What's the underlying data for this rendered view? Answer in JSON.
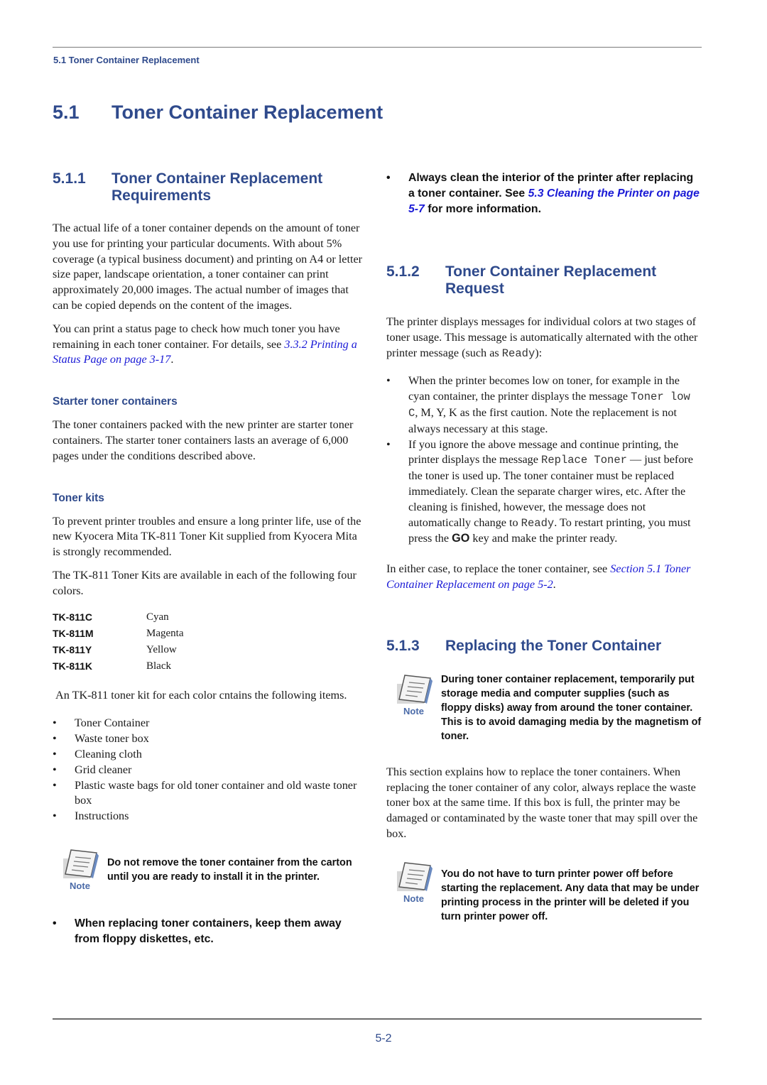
{
  "header": {
    "running_title": "5.1 Toner Container Replacement"
  },
  "section": {
    "number": "5.1",
    "title": "Toner Container Replacement"
  },
  "left": {
    "s511": {
      "number": "5.1.1",
      "title_line1": "Toner Container Replacement",
      "title_line2": "Requirements"
    },
    "para1": "The actual life of a toner container depends on the amount of toner you use for printing your particular documents.  With about 5% coverage (a typical business document) and printing on A4 or letter size paper, landscape orientation, a toner container can print approximately 20,000 images. The actual number of images that can be copied depends on the content of the images.",
    "para2_text": "You can print a status page to check how much toner you have remaining in each toner container. For details, see ",
    "para2_link": "3.3.2 Printing a Status Page on page 3-17",
    "para2_end": ".",
    "starter_heading": "Starter toner containers",
    "starter_para": "The toner containers packed with the new printer are starter toner containers. The starter toner containers lasts an average of 6,000 pages under the conditions described above.",
    "kits_heading": "Toner kits",
    "kits_para1": "To prevent printer troubles and ensure a long printer life, use of the new Kyocera Mita TK-811 Toner Kit supplied from Kyocera Mita is strongly recommended.",
    "kits_para2": "The TK-811 Toner Kits are available in each of the following four colors.",
    "kits": [
      {
        "code": "TK-811C",
        "color": "Cyan"
      },
      {
        "code": "TK-811M",
        "color": "Magenta"
      },
      {
        "code": "TK-811Y",
        "color": "Yellow"
      },
      {
        "code": "TK-811K",
        "color": "Black"
      }
    ],
    "contents_para": " An TK-811 toner kit for each color cntains the following items.",
    "contents": [
      "Toner Container",
      "Waste toner box",
      "Cleaning cloth",
      "Grid cleaner",
      "Plastic waste bags for old toner container and old waste toner box",
      "Instructions"
    ],
    "note": {
      "label": "Note",
      "text": "Do not remove the toner container from the carton until you are ready to install it in the printer."
    },
    "warning": "When replacing toner containers, keep them away from floppy diskettes, etc."
  },
  "right": {
    "clean_bullet_pre": "Always clean the interior of the printer after replacing a toner container. See ",
    "clean_bullet_link": "5.3 Cleaning the Printer on page 5-7",
    "clean_bullet_post": " for more information.",
    "s512": {
      "number": "5.1.2",
      "title_line1": "Toner Container Replacement",
      "title_line2": "Request"
    },
    "request_para_pre": "The printer displays messages for individual colors at two stages of toner usage. This message is automatically alternated with the other printer message (such as ",
    "request_para_code": "Ready",
    "request_para_post": "):",
    "bullet1_pre": "When the printer becomes low on toner, for example in the cyan container, the printer displays the message ",
    "bullet1_code": "Toner low C",
    "bullet1_mid": ", M, Y, K as the first caution. Note the replacement is not always necessary at this stage.",
    "bullet2_pre": "If you ignore the above message and continue printing, the printer displays the message ",
    "bullet2_code": "Replace Toner",
    "bullet2_mid": " — just before the toner is used up. The toner container must be replaced immediately. Clean the separate charger wires, etc. After the cleaning is finished, however, the message does not automatically change to ",
    "bullet2_code2": "Ready",
    "bullet2_mid2": ". To restart printing, you must press the ",
    "bullet2_key": "GO",
    "bullet2_end": " key and make the printer ready.",
    "either_pre": "In either case, to replace the toner container, see ",
    "either_link": "Section 5.1 Toner Container Replacement on page 5-2",
    "either_end": ".",
    "s513": {
      "number": "5.1.3",
      "title": "Replacing the Toner Container"
    },
    "note1": {
      "label": "Note",
      "text": "During toner container replacement, temporarily put storage media and computer supplies (such as floppy disks) away from around the toner container. This is to avoid damaging media by the magnetism of toner."
    },
    "section_para": "This section explains how to replace the toner containers. When replacing the toner container of any color, always replace the waste toner box at the same time. If this box is full, the printer may be damaged or contaminated by the waste toner that may spill over the box.",
    "note2": {
      "label": "Note",
      "text": "You do not have to turn printer power off before starting the replacement. Any data that may be under printing process in the printer will be deleted if you turn printer power off."
    }
  },
  "footer": {
    "page_number": "5-2"
  },
  "colors": {
    "heading": "#2f4a8c",
    "link": "#1a1ad6",
    "rule": "#6b6b6b"
  }
}
